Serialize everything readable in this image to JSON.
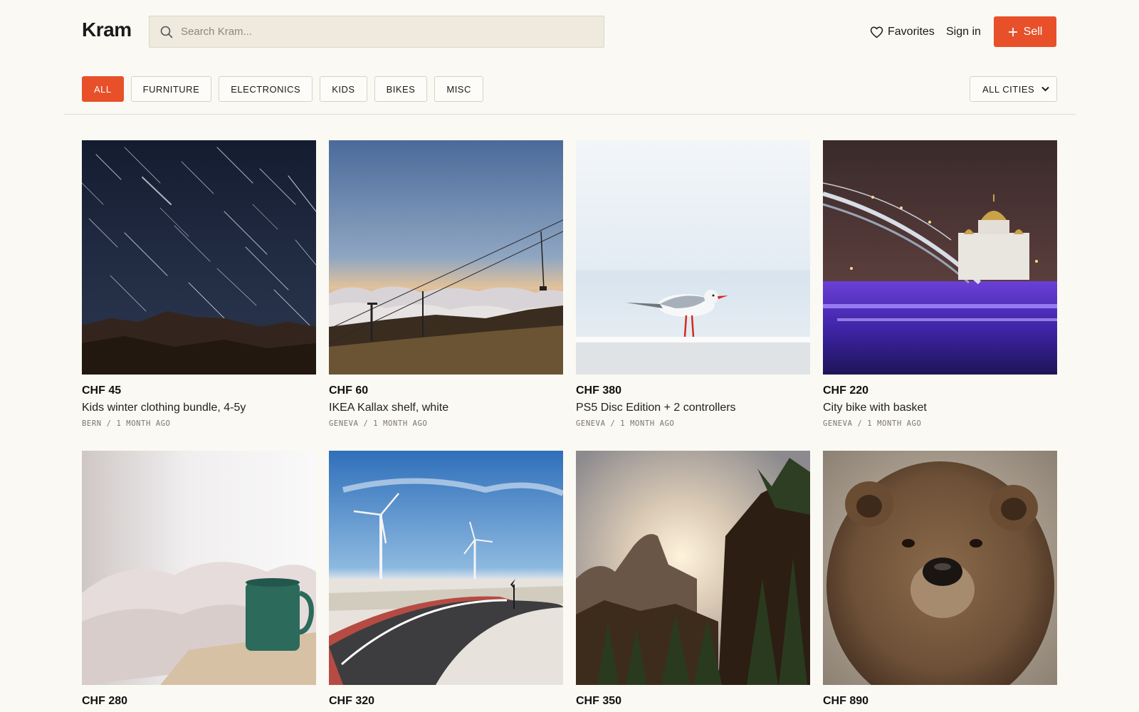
{
  "header": {
    "logo": "Kram",
    "search_placeholder": "Search Kram...",
    "favorites_label": "Favorites",
    "signin_label": "Sign in",
    "sell_label": "Sell"
  },
  "filters": {
    "categories": [
      "ALL",
      "FURNITURE",
      "ELECTRONICS",
      "KIDS",
      "BIKES",
      "MISC"
    ],
    "active": "ALL",
    "city": "ALL CITIES"
  },
  "colors": {
    "accent": "#e8502a",
    "background": "#fbf9f3"
  },
  "listings": [
    {
      "price": "CHF 45",
      "title": "Kids winter clothing bundle, 4-5y",
      "city": "BERN",
      "age": "1 MONTH AGO",
      "image": "star-trails-night"
    },
    {
      "price": "CHF 60",
      "title": "IKEA Kallax shelf, white",
      "city": "GENEVA",
      "age": "1 MONTH AGO",
      "image": "ski-lift-sunset"
    },
    {
      "price": "CHF 380",
      "title": "PS5 Disc Edition + 2 controllers",
      "city": "GENEVA",
      "age": "1 MONTH AGO",
      "image": "seagull-railing"
    },
    {
      "price": "CHF 220",
      "title": "City bike with basket",
      "city": "GENEVA",
      "age": "1 MONTH AGO",
      "image": "bridge-cathedral-night"
    },
    {
      "price": "CHF 280",
      "title": "",
      "city": "",
      "age": "",
      "image": "mug-bedside"
    },
    {
      "price": "CHF 320",
      "title": "",
      "city": "",
      "age": "",
      "image": "road-wind-turbines"
    },
    {
      "price": "CHF 350",
      "title": "",
      "city": "",
      "age": "",
      "image": "valley-sunset"
    },
    {
      "price": "CHF 890",
      "title": "",
      "city": "",
      "age": "",
      "image": "brown-bear"
    }
  ],
  "meta_separator": " / "
}
